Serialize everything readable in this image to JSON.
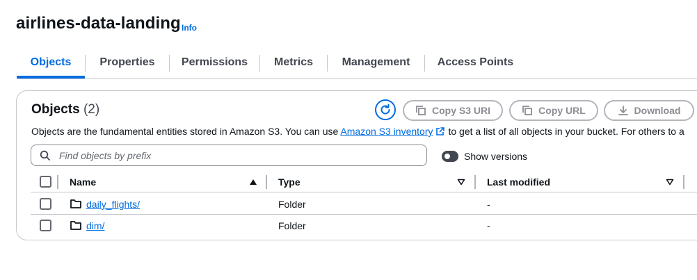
{
  "bucket": {
    "name": "airlines-data-landing",
    "info_label": "Info"
  },
  "tabs": [
    {
      "label": "Objects",
      "active": true
    },
    {
      "label": "Properties",
      "active": false
    },
    {
      "label": "Permissions",
      "active": false
    },
    {
      "label": "Metrics",
      "active": false
    },
    {
      "label": "Management",
      "active": false
    },
    {
      "label": "Access Points",
      "active": false
    }
  ],
  "objects_panel": {
    "title": "Objects",
    "count": "(2)",
    "description_prefix": "Objects are the fundamental entities stored in Amazon S3. You can use ",
    "description_link": "Amazon S3 inventory",
    "description_suffix": "to get a list of all objects in your bucket. For others to a",
    "actions": {
      "copy_uri": "Copy S3 URI",
      "copy_url": "Copy URL",
      "download": "Download"
    },
    "search_placeholder": "Find objects by prefix",
    "show_versions_label": "Show versions",
    "show_versions_on": false
  },
  "table": {
    "columns": [
      "Name",
      "Type",
      "Last modified"
    ],
    "rows": [
      {
        "name": "daily_flights/",
        "type": "Folder",
        "last_modified": "-"
      },
      {
        "name": "dim/",
        "type": "Folder",
        "last_modified": "-"
      }
    ]
  },
  "colors": {
    "accent": "#006ce0",
    "text": "#0f141a",
    "border": "#c6c6cd",
    "disabled": "#8c8c94"
  },
  "icons": [
    "refresh-icon",
    "copy-icon",
    "download-icon",
    "external-link-icon",
    "search-icon",
    "folder-icon",
    "sort-ascending-icon",
    "sort-descending-icon"
  ]
}
